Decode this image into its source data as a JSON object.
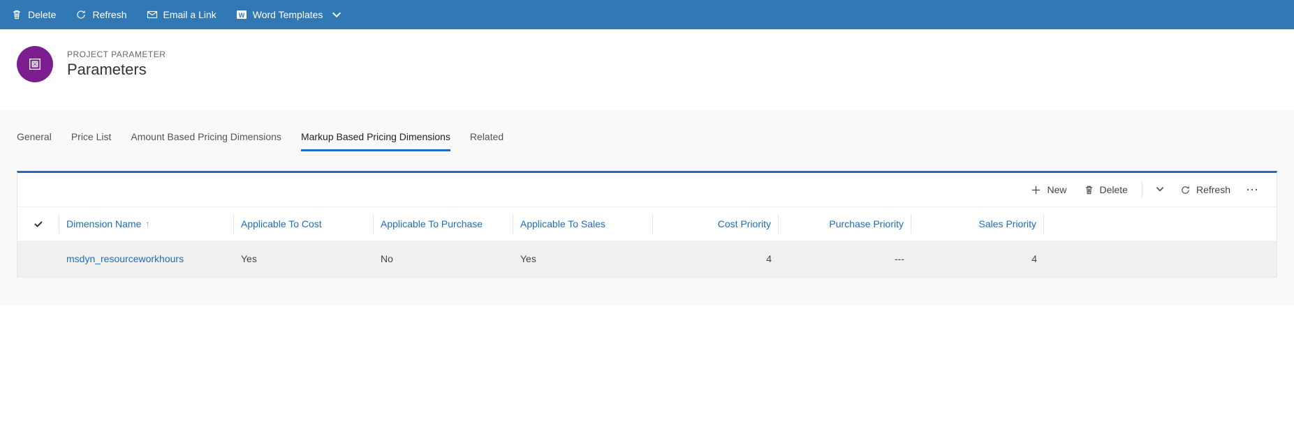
{
  "commandBar": {
    "delete": "Delete",
    "refresh": "Refresh",
    "emailLink": "Email a Link",
    "wordTemplates": "Word Templates"
  },
  "header": {
    "subtitle": "PROJECT PARAMETER",
    "title": "Parameters"
  },
  "tabs": {
    "general": "General",
    "priceList": "Price List",
    "amountBased": "Amount Based Pricing Dimensions",
    "markupBased": "Markup Based Pricing Dimensions",
    "related": "Related"
  },
  "panelToolbar": {
    "new": "New",
    "delete": "Delete",
    "refresh": "Refresh"
  },
  "grid": {
    "columns": {
      "dimensionName": "Dimension Name",
      "applicableToCost": "Applicable To Cost",
      "applicableToPurchase": "Applicable To Purchase",
      "applicableToSales": "Applicable To Sales",
      "costPriority": "Cost Priority",
      "purchasePriority": "Purchase Priority",
      "salesPriority": "Sales Priority"
    },
    "rows": [
      {
        "dimensionName": "msdyn_resourceworkhours",
        "applicableToCost": "Yes",
        "applicableToPurchase": "No",
        "applicableToSales": "Yes",
        "costPriority": "4",
        "purchasePriority": "---",
        "salesPriority": "4"
      }
    ]
  }
}
